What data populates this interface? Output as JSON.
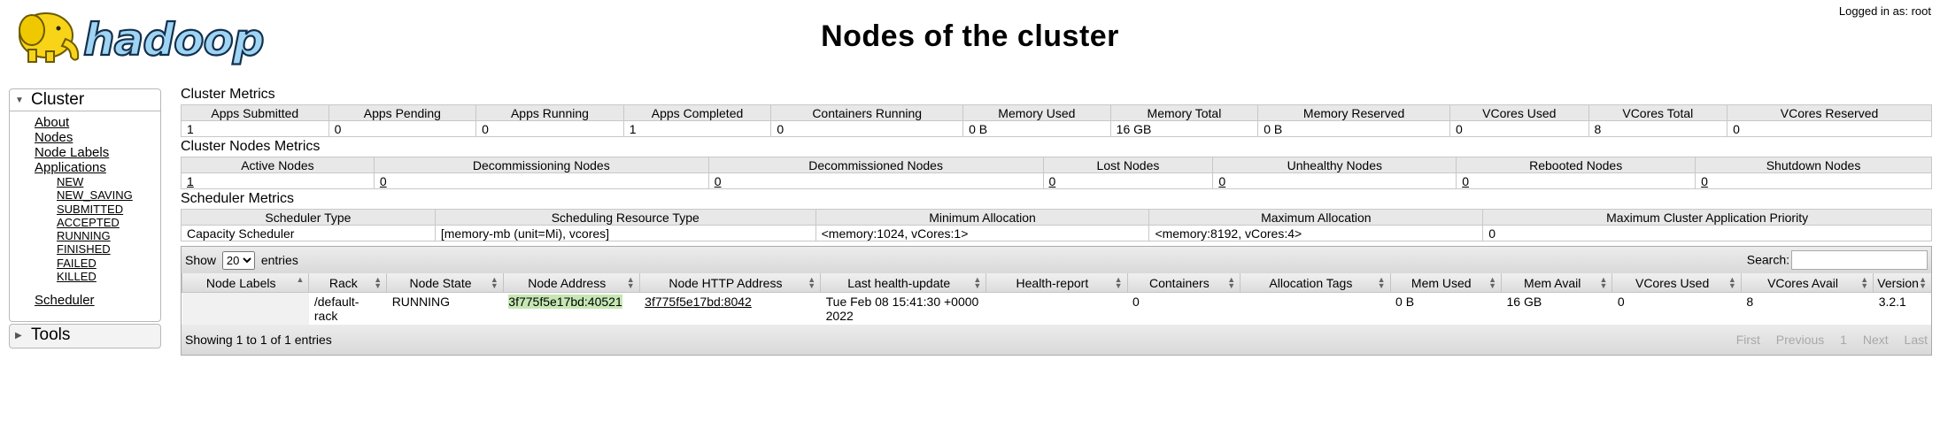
{
  "header": {
    "logo_text": "hadoop",
    "title": "Nodes of the cluster",
    "login": "Logged in as: root"
  },
  "nav": {
    "cluster_label": "Cluster",
    "links": [
      "About",
      "Nodes",
      "Node Labels",
      "Applications"
    ],
    "app_states": [
      "NEW",
      "NEW_SAVING",
      "SUBMITTED",
      "ACCEPTED",
      "RUNNING",
      "FINISHED",
      "FAILED",
      "KILLED"
    ],
    "scheduler": "Scheduler",
    "tools_label": "Tools"
  },
  "cluster_metrics": {
    "title": "Cluster Metrics",
    "headers": [
      "Apps Submitted",
      "Apps Pending",
      "Apps Running",
      "Apps Completed",
      "Containers Running",
      "Memory Used",
      "Memory Total",
      "Memory Reserved",
      "VCores Used",
      "VCores Total",
      "VCores Reserved"
    ],
    "values": [
      "1",
      "0",
      "0",
      "1",
      "0",
      "0 B",
      "16 GB",
      "0 B",
      "0",
      "8",
      "0"
    ]
  },
  "nodes_metrics": {
    "title": "Cluster Nodes Metrics",
    "headers": [
      "Active Nodes",
      "Decommissioning Nodes",
      "Decommissioned Nodes",
      "Lost Nodes",
      "Unhealthy Nodes",
      "Rebooted Nodes",
      "Shutdown Nodes"
    ],
    "values": [
      "1",
      "0",
      "0",
      "0",
      "0",
      "0",
      "0"
    ]
  },
  "scheduler_metrics": {
    "title": "Scheduler Metrics",
    "headers": [
      "Scheduler Type",
      "Scheduling Resource Type",
      "Minimum Allocation",
      "Maximum Allocation",
      "Maximum Cluster Application Priority"
    ],
    "values": [
      "Capacity Scheduler",
      "[memory-mb (unit=Mi), vcores]",
      "<memory:1024, vCores:1>",
      "<memory:8192, vCores:4>",
      "0"
    ]
  },
  "nodes_table": {
    "show_label": "Show",
    "page_size": "20",
    "entries_label": "entries",
    "search_label": "Search:",
    "search_value": "",
    "columns": [
      "Node Labels",
      "Rack",
      "Node State",
      "Node Address",
      "Node HTTP Address",
      "Last health-update",
      "Health-report",
      "Containers",
      "Allocation Tags",
      "Mem Used",
      "Mem Avail",
      "VCores Used",
      "VCores Avail",
      "Version"
    ],
    "rows": [
      {
        "node_labels": "",
        "rack": "/default-rack",
        "state": "RUNNING",
        "address": "3f775f5e17bd:40521",
        "http_address": "3f775f5e17bd:8042",
        "last_health": "Tue Feb 08 15:41:30 +0000 2022",
        "health_report": "",
        "containers": "0",
        "alloc_tags": "",
        "mem_used": "0 B",
        "mem_avail": "16 GB",
        "vcores_used": "0",
        "vcores_avail": "8",
        "version": "3.2.1"
      }
    ],
    "info": "Showing 1 to 1 of 1 entries",
    "pager": [
      "First",
      "Previous",
      "1",
      "Next",
      "Last"
    ]
  },
  "colors": {
    "header_bg": "#e8e8e8",
    "highlight": "#c6e7b3",
    "logo_blue": "#1b5a8a",
    "elephant": "#f7d417"
  }
}
